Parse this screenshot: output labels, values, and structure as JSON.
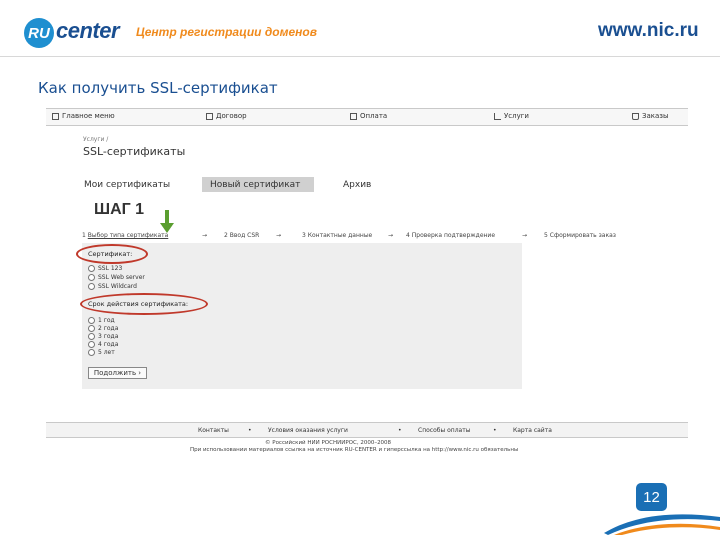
{
  "header": {
    "logo_ru": "RU",
    "logo_center": "center",
    "tagline": "Центр регистрации доменов",
    "site_url": "www.nic.ru"
  },
  "slide": {
    "title": "Как получить SSL-сертификат",
    "page_number": "12"
  },
  "nav": {
    "items": [
      {
        "label": "Главное меню",
        "icon": "home-icon"
      },
      {
        "label": "Договор",
        "icon": "document-icon"
      },
      {
        "label": "Оплата",
        "icon": "payment-icon"
      },
      {
        "label": "Услуги",
        "icon": "services-icon"
      },
      {
        "label": "Заказы",
        "icon": "cart-icon"
      }
    ]
  },
  "page": {
    "breadcrumb": "Услуги /",
    "heading": "SSL-сертификаты",
    "tabs": [
      "Мои сертификаты",
      "Новый сертификат",
      "Архив"
    ],
    "active_tab": "Новый сертификат"
  },
  "wizard": {
    "step_label": "ШАГ 1",
    "steps": [
      {
        "num": "1",
        "label": "Выбор типа сертификата"
      },
      {
        "num": "2",
        "label": "Ввод CSR"
      },
      {
        "num": "3",
        "label": "Контактные данные"
      },
      {
        "num": "4",
        "label": "Проверка подтверждение"
      },
      {
        "num": "5",
        "label": "Сформировать заказ"
      }
    ],
    "arrow": "→"
  },
  "form": {
    "cert_label": "Сертификат:",
    "cert_options": [
      "SSL 123",
      "SSL Web server",
      "SSL Wildcard"
    ],
    "term_label": "Срок действия сертификата:",
    "term_options": [
      "1 год",
      "2 года",
      "3 года",
      "4 года",
      "5 лет"
    ],
    "next_button": "Подолжить"
  },
  "footer": {
    "links": [
      "Контакты",
      "Условия оказания услуги",
      "Способы оплаты",
      "Карта сайта"
    ],
    "separator": "•",
    "copyright": "© Российский НИИ РОСНИИРОС, 2000–2008",
    "note": "При использовании материалов ссылка на источник RU-CENTER и гиперссылка на http://www.nic.ru обязательны"
  },
  "colors": {
    "brand_blue": "#1a4f91",
    "brand_orange": "#f08a1c",
    "highlight_red": "#c0392b",
    "arrow_green": "#5a9e2f",
    "badge_blue": "#1a6fb5"
  }
}
